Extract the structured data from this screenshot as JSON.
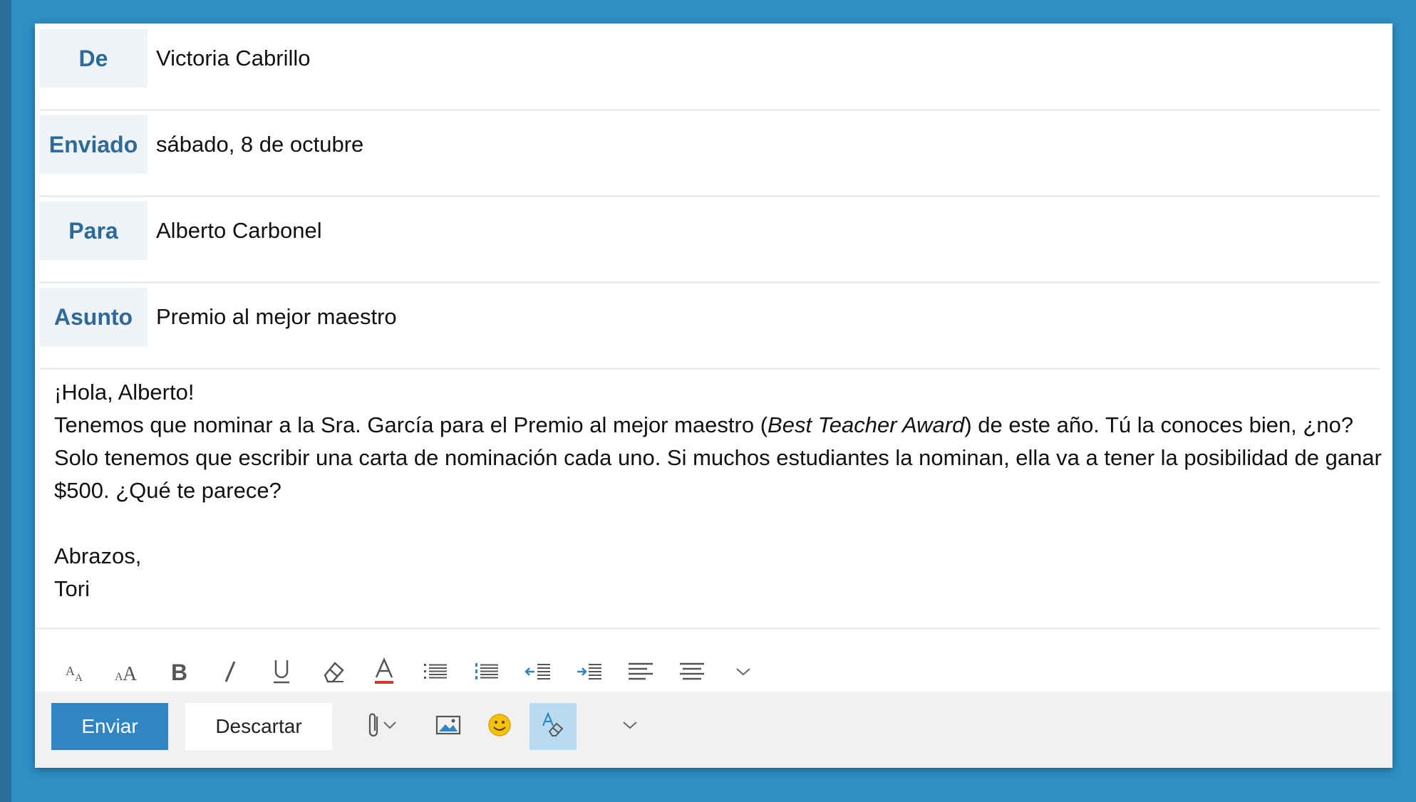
{
  "header": {
    "from": {
      "label": "De",
      "value": "Victoria Cabrillo"
    },
    "sent": {
      "label": "Enviado",
      "value": "sábado, 8 de octubre"
    },
    "to": {
      "label": "Para",
      "value": "Alberto Carbonel"
    },
    "subject": {
      "label": "Asunto",
      "value": "Premio al mejor maestro"
    }
  },
  "body": {
    "greeting": "¡Hola, Alberto!",
    "p1_before": "Tenemos que nominar a la Sra. García para el Premio al mejor maestro (",
    "p1_italic": "Best Teacher Award",
    "p1_after": ") de este año. Tú la conoces bien, ¿no? Solo tenemos que escribir una carta de nominación cada uno. Si muchos estudiantes la nominan, ella va a tener la posibilidad de ganar $500. ¿Qué te parece?",
    "closing": "Abrazos,",
    "signature": "Tori"
  },
  "actions": {
    "send_label": "Enviar",
    "discard_label": "Descartar"
  },
  "formatting_icons": [
    "font-size-decrease-icon",
    "font-size-increase-icon",
    "bold-icon",
    "italic-icon",
    "underline-icon",
    "eraser-icon",
    "font-color-icon",
    "bullet-list-icon",
    "numbered-list-icon",
    "outdent-icon",
    "indent-icon",
    "align-left-icon",
    "align-center-icon",
    "chevron-down-icon"
  ],
  "action_icons": [
    "paperclip-icon",
    "image-icon",
    "emoji-icon",
    "format-icon",
    "chevron-down-icon"
  ],
  "colors": {
    "background": "#2e8fc5",
    "accent": "#2f86c2",
    "label_text": "#2d6a96",
    "label_bg": "#eef3f7",
    "font_color_underline": "#d9342b",
    "emoji": "#f4c20d"
  }
}
